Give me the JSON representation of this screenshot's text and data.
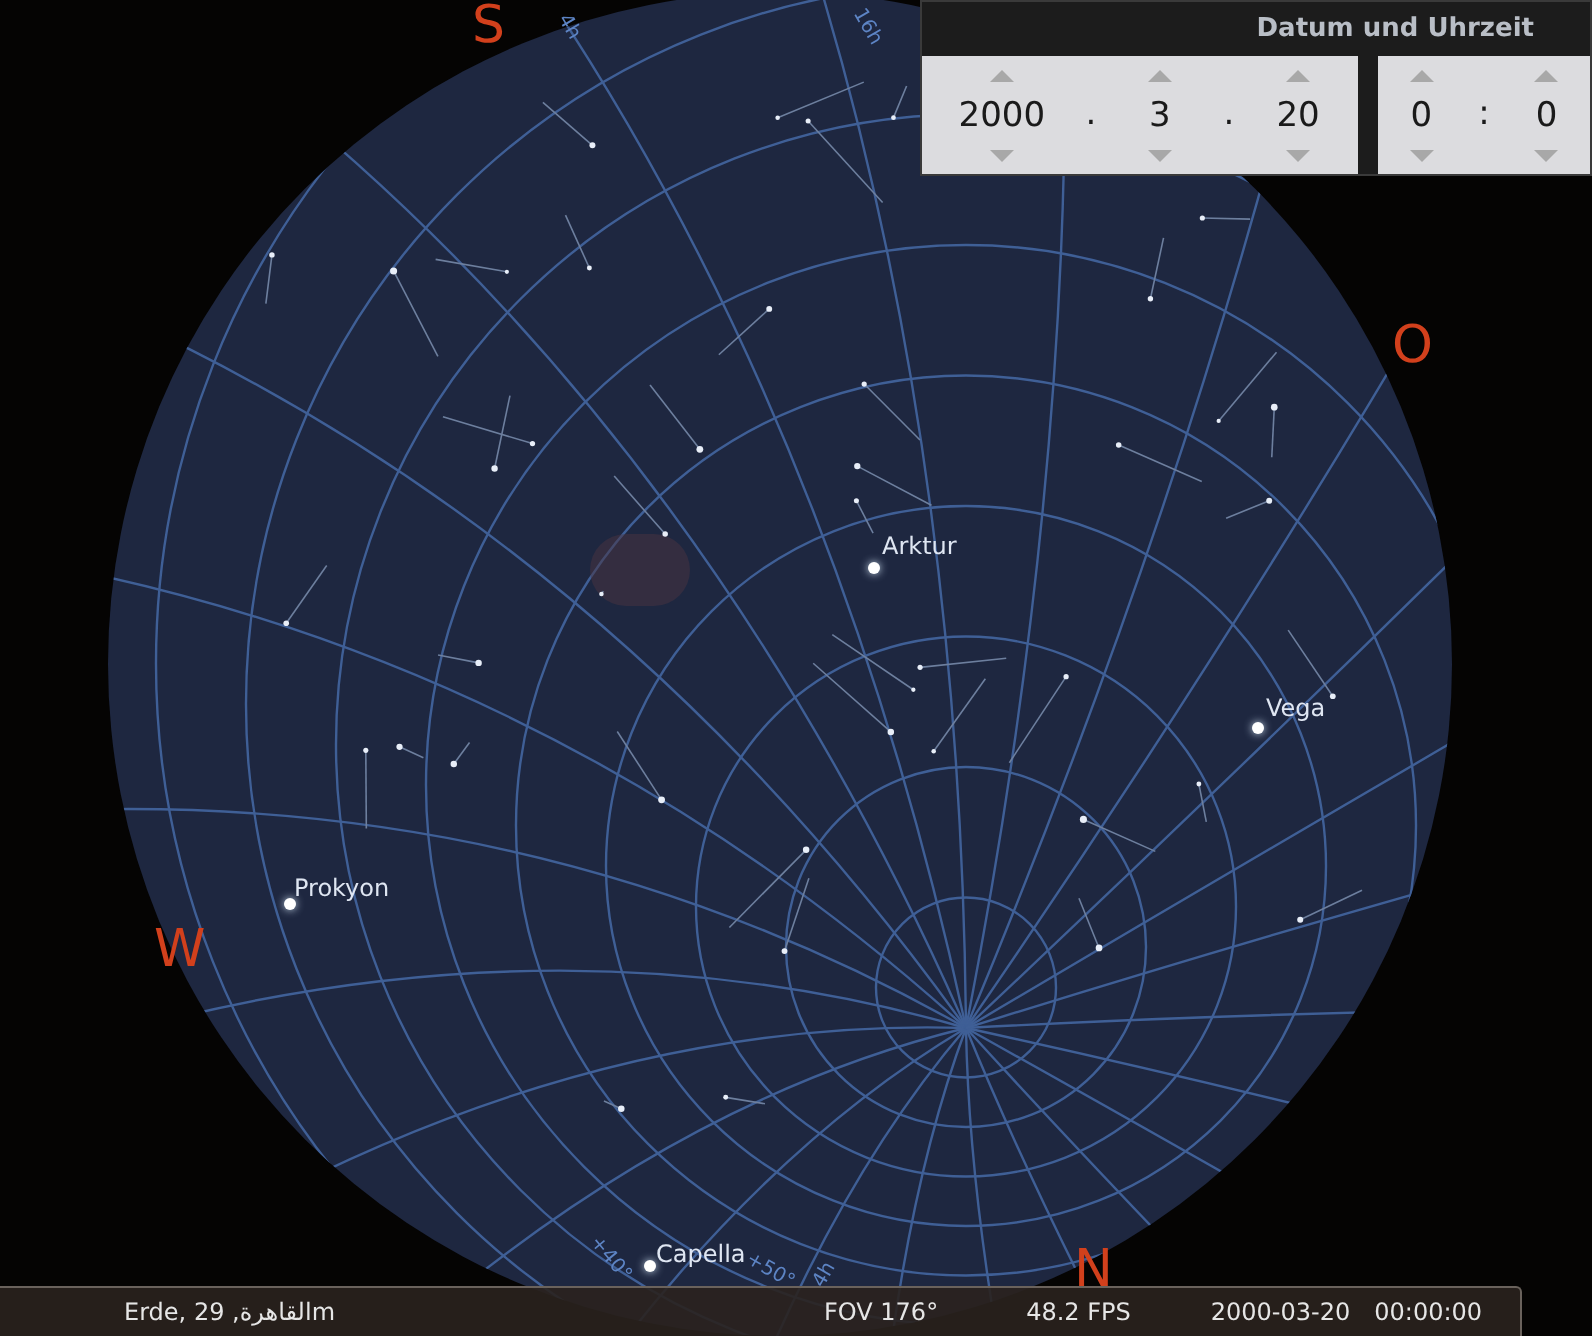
{
  "compass": [
    {
      "label": "S"
    },
    {
      "label": "O"
    },
    {
      "label": "W"
    },
    {
      "label": "N"
    }
  ],
  "stars": [
    {
      "name": "Arktur"
    },
    {
      "name": "Vega"
    },
    {
      "name": "Prokyon"
    },
    {
      "name": "Capella"
    }
  ],
  "grid_labels": [
    "4h",
    "16h",
    "+40°",
    "+50°",
    "4h"
  ],
  "date_time_panel": {
    "title": "Datum und Uhrzeit",
    "date_fields": [
      "2000",
      "3",
      "20"
    ],
    "date_separators": [
      ".",
      "."
    ],
    "time_fields": [
      "0",
      "0"
    ],
    "time_separator": ":"
  },
  "status_bar": {
    "location": "Erde, القاهرة, 29m",
    "fov": "FOV 176°",
    "fps": "48.2 FPS",
    "date": "2000-03-20",
    "time": "00:00:00"
  }
}
